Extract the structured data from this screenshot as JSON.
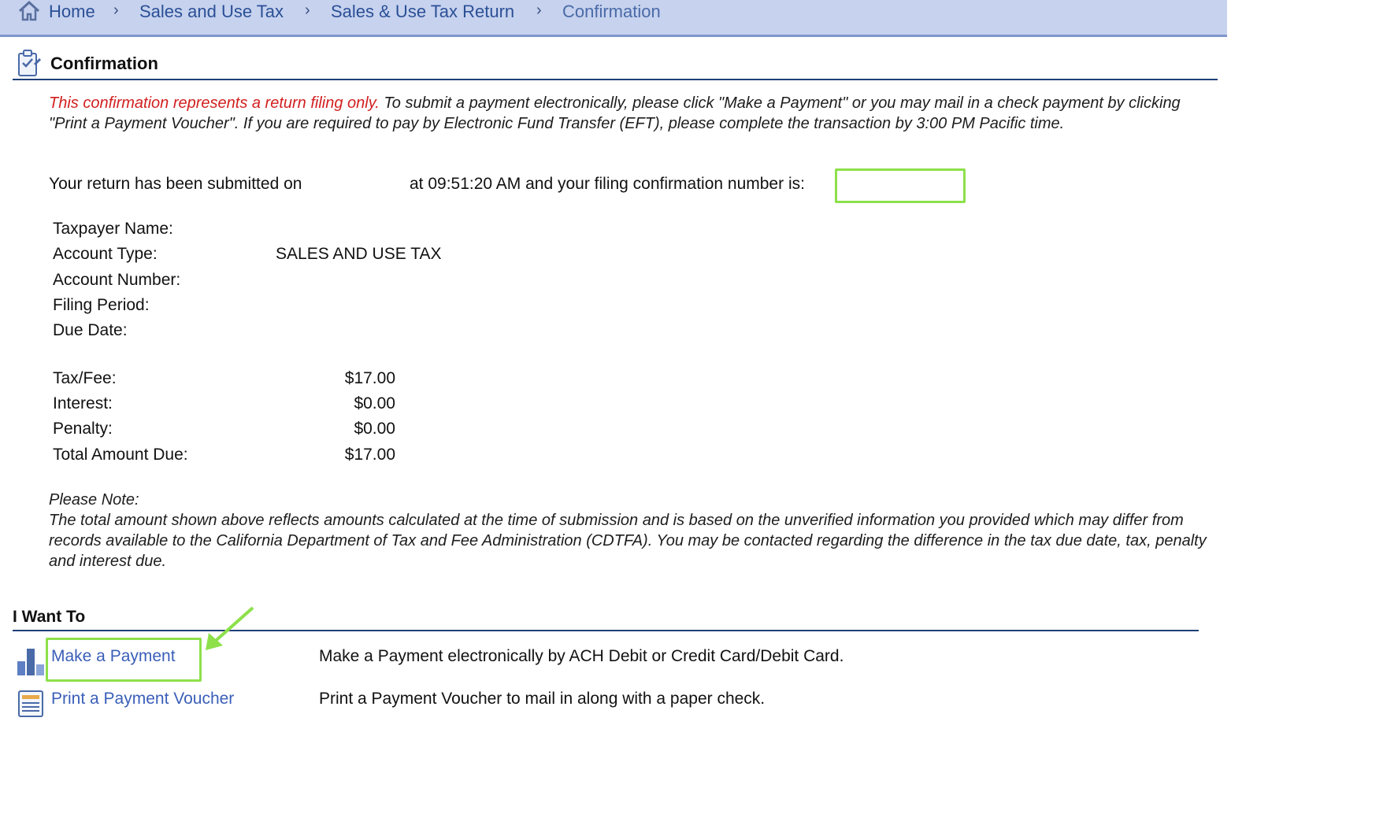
{
  "breadcrumb": {
    "items": [
      "Home",
      "Sales and Use Tax",
      "Sales & Use Tax Return",
      "Confirmation"
    ],
    "separator": "›"
  },
  "section": {
    "title": "Confirmation"
  },
  "intro": {
    "red_text": "This confirmation represents a return filing only.",
    "rest_text": " To submit a payment electronically, please click \"Make a Payment\" or you may mail in a check payment by clicking \"Print a Payment Voucher\". If you are required to pay by Electronic Fund Transfer (EFT), please complete the transaction by 3:00 PM Pacific time."
  },
  "submission": {
    "prefix": "Your return has been submitted on",
    "suffix": "at 09:51:20 AM and your filing confirmation number is:"
  },
  "details": [
    {
      "label": "Taxpayer Name:",
      "value": ""
    },
    {
      "label": "Account Type:",
      "value": "SALES AND USE TAX"
    },
    {
      "label": "Account Number:",
      "value": ""
    },
    {
      "label": "Filing Period:",
      "value": ""
    },
    {
      "label": "Due Date:",
      "value": ""
    }
  ],
  "amounts": [
    {
      "label": "Tax/Fee:",
      "value": "$17.00"
    },
    {
      "label": "Interest:",
      "value": "$0.00"
    },
    {
      "label": "Penalty:",
      "value": "$0.00"
    },
    {
      "label": "Total Amount Due:",
      "value": "$17.00"
    }
  ],
  "note": {
    "heading": "Please Note:",
    "body": "The total amount shown above reflects amounts calculated at the time of submission and is based on the unverified information you provided which may differ from records available to the California Department of Tax and Fee Administration (CDTFA). You may be contacted regarding the difference in the tax due date, tax, penalty and interest due."
  },
  "want_to": {
    "title": "I Want To",
    "actions": [
      {
        "label": "Make a Payment",
        "description": "Make a Payment electronically by ACH Debit or Credit Card/Debit Card."
      },
      {
        "label": "Print a Payment Voucher",
        "description": "Print a Payment Voucher to mail in along with a paper check."
      }
    ]
  },
  "colors": {
    "highlight": "#8de04a",
    "link": "#3a5fb8",
    "warning": "#d21f1f",
    "breadcrumb_bg": "#c6d2ee"
  }
}
